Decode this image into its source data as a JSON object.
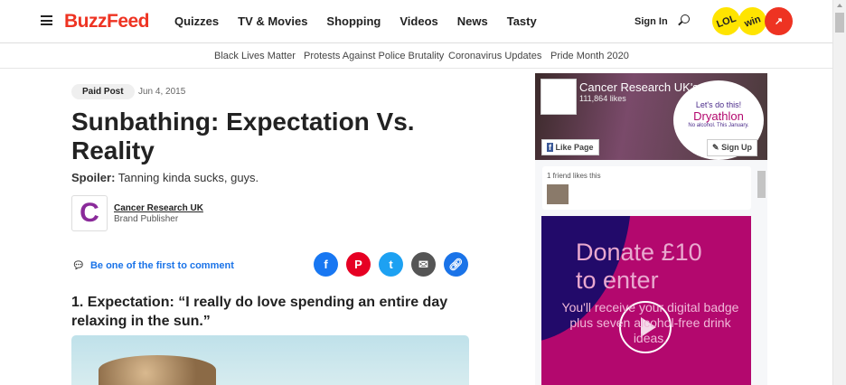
{
  "header": {
    "logo": "BuzzFeed",
    "nav": [
      "Quizzes",
      "TV & Movies",
      "Shopping",
      "Videos",
      "News",
      "Tasty"
    ],
    "sign_in": "Sign In",
    "badges": [
      "LOL",
      "win"
    ]
  },
  "subnav": [
    "Black Lives Matter",
    "Protests Against Police Brutality",
    "Coronavirus Updates",
    "Pride Month 2020"
  ],
  "article": {
    "tag": "Paid Post",
    "date": "Jun 4, 2015",
    "title": "Sunbathing: Expectation Vs. Reality",
    "desc_label": "Spoiler:",
    "desc": "Tanning kinda sucks, guys.",
    "publisher": "Cancer Research UK",
    "publisher_role": "Brand Publisher",
    "comment": "Be one of the first to comment",
    "section1": "1. Expectation: “I really do love spending an entire day relaxing in the sun.”"
  },
  "share": {
    "colors": {
      "facebook": "#1877f2",
      "pinterest": "#e60023",
      "twitter": "#1da1f2",
      "email": "#555555",
      "link": "#1a73e8"
    }
  },
  "sidebar": {
    "page_name": "Cancer Research UK's Dryat...",
    "likes": "111,864 likes",
    "like_btn": "Like Page",
    "signup_btn": "Sign Up",
    "cover_line1": "Let's do this!",
    "cover_brand": "Dryathlon",
    "cover_line2": "No alcohol. This January.",
    "friends": "1 friend likes this",
    "ad_headline1": "Donate £10",
    "ad_headline2": "to enter",
    "ad_body": "You'll receive your digital badge plus seven alcohol-free drink ideas."
  }
}
